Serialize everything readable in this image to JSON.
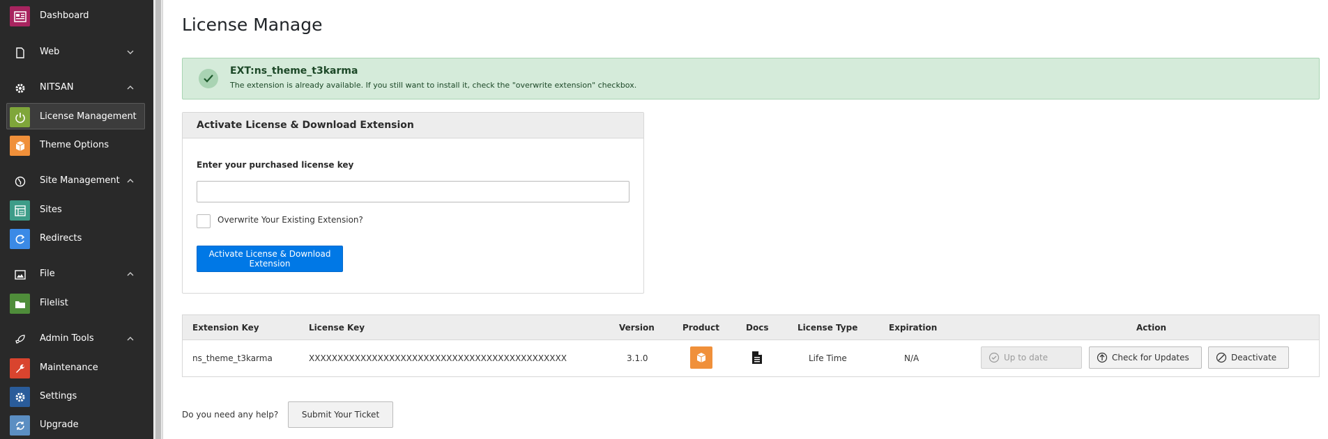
{
  "sidebar": {
    "dashboard": {
      "label": "Dashboard",
      "color": "#a8245f"
    },
    "web": {
      "label": "Web"
    },
    "nitsan": {
      "label": "NITSAN"
    },
    "license_management": {
      "label": "License Management",
      "color": "#7fa63a"
    },
    "theme_options": {
      "label": "Theme Options",
      "color": "#f0903a"
    },
    "site_management": {
      "label": "Site Management"
    },
    "sites": {
      "label": "Sites",
      "color": "#3d9c88"
    },
    "redirects": {
      "label": "Redirects",
      "color": "#3b8ae6"
    },
    "file": {
      "label": "File"
    },
    "filelist": {
      "label": "Filelist",
      "color": "#4f8d3a"
    },
    "admin_tools": {
      "label": "Admin Tools"
    },
    "maintenance": {
      "label": "Maintenance",
      "color": "#d9442e"
    },
    "settings": {
      "label": "Settings",
      "color": "#2a5c9a"
    },
    "upgrade": {
      "label": "Upgrade",
      "color": "#5b8ec2"
    }
  },
  "page": {
    "title": "License Manage"
  },
  "alert": {
    "title": "EXT:ns_theme_t3karma",
    "message": "The extension is already available. If you still want to install it, check the \"overwrite extension\" checkbox."
  },
  "activate_panel": {
    "title": "Activate License & Download Extension",
    "field_label": "Enter your purchased license key",
    "license_key_value": "",
    "overwrite_label": "Overwrite Your Existing Extension?",
    "submit_label": "Activate License & Download Extension"
  },
  "table": {
    "headers": {
      "extension_key": "Extension Key",
      "license_key": "License Key",
      "version": "Version",
      "product": "Product",
      "docs": "Docs",
      "license_type": "License Type",
      "expiration": "Expiration",
      "action": "Action"
    },
    "rows": [
      {
        "extension_key": "ns_theme_t3karma",
        "license_key": "XXXXXXXXXXXXXXXXXXXXXXXXXXXXXXXXXXXXXXXXXXXXX",
        "version": "3.1.0",
        "license_type": "Life Time",
        "expiration": "N/A",
        "up_to_date_label": "Up to date",
        "check_updates_label": "Check for Updates",
        "deactivate_label": "Deactivate"
      }
    ]
  },
  "help": {
    "text": "Do you need any help?",
    "ticket_label": "Submit Your Ticket"
  }
}
